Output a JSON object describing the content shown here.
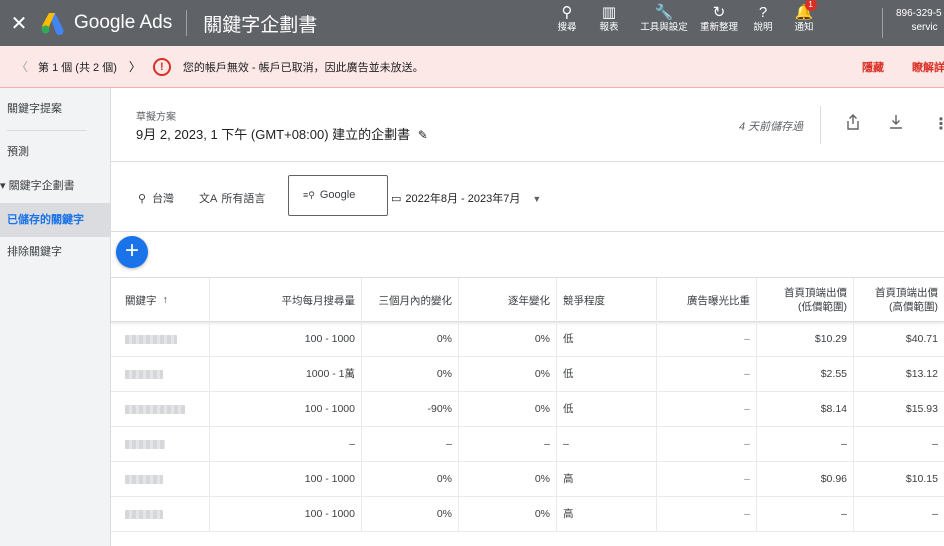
{
  "topbar": {
    "close_icon": "close-icon",
    "brand": "Google Ads",
    "page_title": "關鍵字企劃書",
    "tools": [
      {
        "name": "search",
        "icon": "search-icon",
        "glyph": "⚲",
        "label": "搜尋"
      },
      {
        "name": "reports",
        "icon": "reports-icon",
        "glyph": "▥",
        "label": "報表"
      },
      {
        "name": "tools",
        "icon": "wrench-icon",
        "glyph": "🔧",
        "label": "工具與設定"
      },
      {
        "name": "refresh",
        "icon": "refresh-icon",
        "glyph": "↻",
        "label": "重新整理"
      },
      {
        "name": "help",
        "icon": "help-icon",
        "glyph": "?",
        "label": "說明"
      },
      {
        "name": "notifications",
        "icon": "bell-icon",
        "glyph": "🔔",
        "label": "通知",
        "badge": "1"
      }
    ],
    "account_id": "896-329-5",
    "account_sub": "servic"
  },
  "alert": {
    "pager": "第 1 個 (共 2 個)",
    "message": "您的帳戶無效 - 帳戶已取消，因此廣告並未放送。",
    "hide_label": "隱藏",
    "learn_label": "瞭解詳"
  },
  "sidebar": {
    "items": [
      {
        "label": "關鍵字提案",
        "active": false
      },
      {
        "label": "預測",
        "active": false
      },
      {
        "label": "▾ 關鍵字企劃書",
        "active": false
      },
      {
        "label": "已儲存的關鍵字",
        "active": true
      },
      {
        "label": "排除關鍵字",
        "active": false
      }
    ]
  },
  "plan": {
    "kind": "草擬方案",
    "name": "9月 2, 2023, 1 下午 (GMT+08:00) 建立的企劃書",
    "saved": "4 天前儲存過"
  },
  "filters": {
    "location": "台灣",
    "language": "所有語言",
    "network": "Google",
    "date_range": "2022年8月 - 2023年7月"
  },
  "table": {
    "headers": {
      "keyword": "關鍵字",
      "monthly": "平均每月搜尋量",
      "three_month": "三個月內的變化",
      "yoy": "逐年變化",
      "competition": "競爭程度",
      "impr_share": "廣告曝光比重",
      "bid_low_1": "首頁頂端出價",
      "bid_low_2": "(低價範圍)",
      "bid_high_1": "首頁頂端出價",
      "bid_high_2": "(高價範圍)"
    },
    "rows": [
      {
        "monthly": "100 - 1000",
        "three_month": "0%",
        "yoy": "0%",
        "competition": "低",
        "impr_share": "–",
        "bid_low": "$10.29",
        "bid_high": "$40.71"
      },
      {
        "monthly": "1000 - 1萬",
        "three_month": "0%",
        "yoy": "0%",
        "competition": "低",
        "impr_share": "–",
        "bid_low": "$2.55",
        "bid_high": "$13.12"
      },
      {
        "monthly": "100 - 1000",
        "three_month": "-90%",
        "yoy": "0%",
        "competition": "低",
        "impr_share": "–",
        "bid_low": "$8.14",
        "bid_high": "$15.93"
      },
      {
        "monthly": "–",
        "three_month": "–",
        "yoy": "–",
        "competition": "–",
        "impr_share": "–",
        "bid_low": "–",
        "bid_high": "–"
      },
      {
        "monthly": "100 - 1000",
        "three_month": "0%",
        "yoy": "0%",
        "competition": "高",
        "impr_share": "–",
        "bid_low": "$0.96",
        "bid_high": "$10.15"
      },
      {
        "monthly": "100 - 1000",
        "three_month": "0%",
        "yoy": "0%",
        "competition": "高",
        "impr_share": "–",
        "bid_low": "–",
        "bid_high": "–"
      }
    ]
  },
  "colors": {
    "topbar": "#5f6368",
    "alert_bg": "#fce8e6",
    "error": "#d93025",
    "accent": "#1a73e8"
  }
}
